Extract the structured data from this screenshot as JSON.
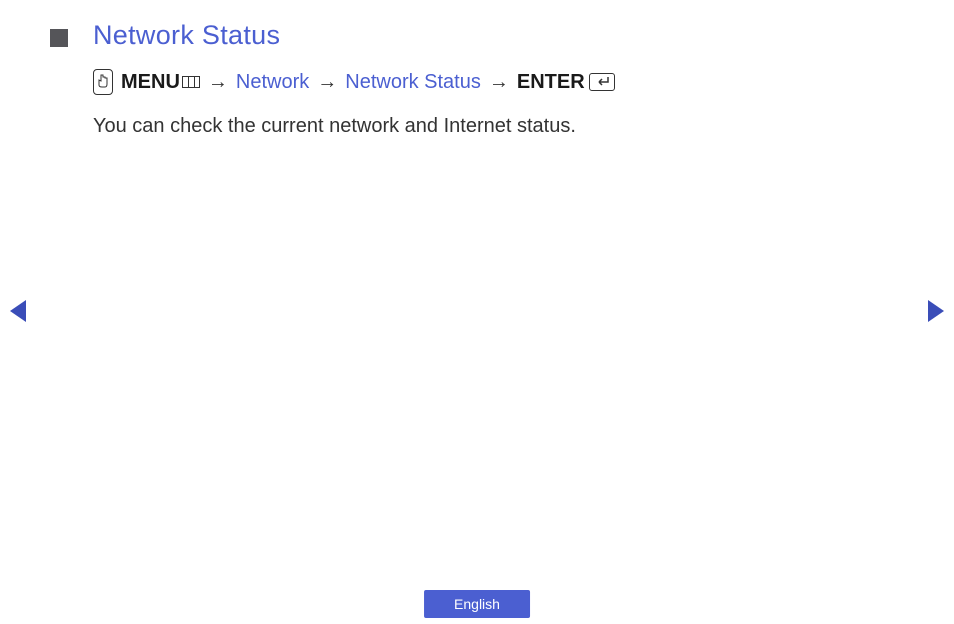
{
  "title": "Network Status",
  "breadcrumb": {
    "menu": "MENU",
    "network": "Network",
    "networkStatus": "Network Status",
    "enter": "ENTER"
  },
  "arrow": "→",
  "description": "You can check the current network and Internet status.",
  "language": "English"
}
